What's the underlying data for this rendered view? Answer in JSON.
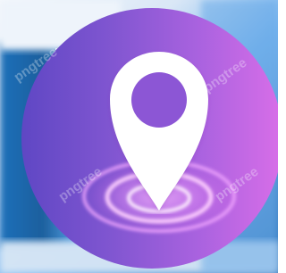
{
  "scene": {
    "subject": "location-pin-icon",
    "background_colors": [
      "#e8f1fa",
      "#6bb2ee",
      "#1c6fb5",
      "#124f8d"
    ],
    "circle_gradient": [
      "#5f47c4",
      "#8258d3",
      "#b064e3",
      "#d86ee8"
    ],
    "pin_color": "#ffffff",
    "ripple_colors": [
      "#f5b2ff",
      "#df7df2",
      "#c55ed9"
    ]
  },
  "watermark": {
    "text": "pngtree",
    "color": "#ffffff"
  }
}
